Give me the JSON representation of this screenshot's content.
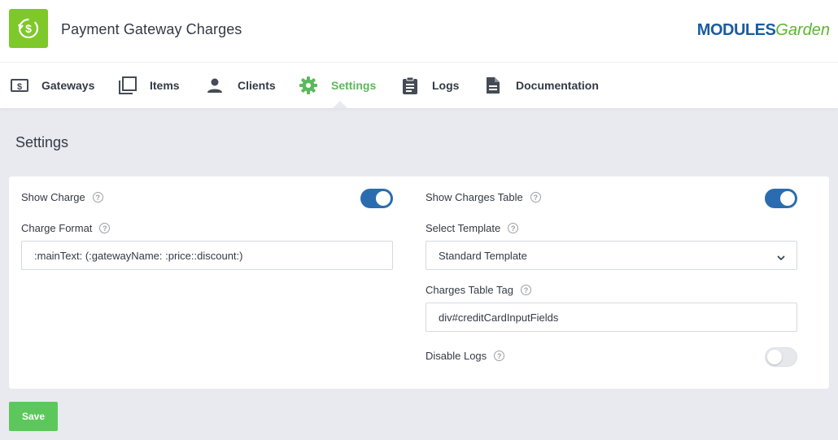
{
  "app": {
    "title": "Payment Gateway Charges",
    "icon": "dollar-refresh-icon",
    "accent": "#7ec82a",
    "brand_part1": "MODULES",
    "brand_part2": "Garden"
  },
  "nav": {
    "items": [
      {
        "label": "Gateways",
        "icon": "money-icon"
      },
      {
        "label": "Items",
        "icon": "copy-icon"
      },
      {
        "label": "Clients",
        "icon": "user-icon"
      },
      {
        "label": "Settings",
        "icon": "gear-icon",
        "active": true
      },
      {
        "label": "Logs",
        "icon": "clipboard-icon"
      },
      {
        "label": "Documentation",
        "icon": "document-icon"
      }
    ],
    "active_color": "#5cb85c"
  },
  "page": {
    "title": "Settings"
  },
  "settings": {
    "show_charge": {
      "label": "Show Charge",
      "enabled": true
    },
    "charge_format": {
      "label": "Charge Format",
      "value": ":mainText: (:gatewayName: :price::discount:)"
    },
    "show_charges_table": {
      "label": "Show Charges Table",
      "enabled": true
    },
    "select_template": {
      "label": "Select Template",
      "value": "Standard Template"
    },
    "charges_table_tag": {
      "label": "Charges Table Tag",
      "value": "div#creditCardInputFields"
    },
    "disable_logs": {
      "label": "Disable Logs",
      "enabled": false
    },
    "help_glyph": "?"
  },
  "actions": {
    "save_label": "Save"
  },
  "colors": {
    "toggle_on": "#2b6cb0",
    "save_button": "#5cc85c"
  }
}
